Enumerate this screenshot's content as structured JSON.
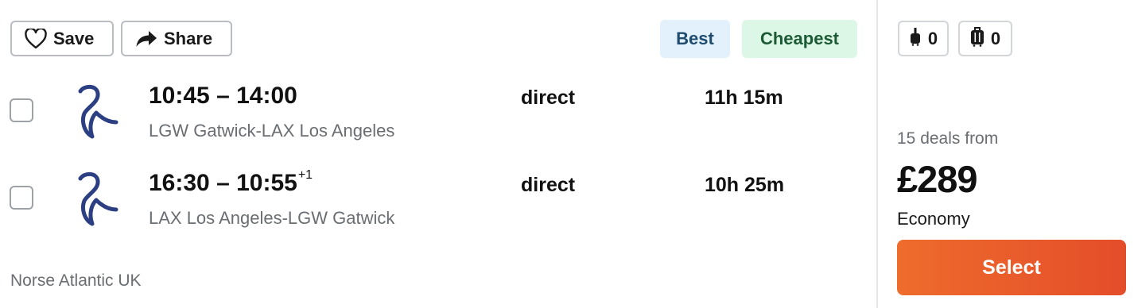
{
  "actions": {
    "save_label": "Save",
    "share_label": "Share"
  },
  "badges": {
    "best": "Best",
    "cheapest": "Cheapest"
  },
  "bags": {
    "carry_on_count": "0",
    "checked_count": "0"
  },
  "legs": [
    {
      "time": "10:45 – 14:00",
      "day_offset": "",
      "route": "LGW Gatwick-LAX Los Angeles",
      "stops": "direct",
      "duration": "11h 15m"
    },
    {
      "time": "16:30 – 10:55",
      "day_offset": "+1",
      "route": "LAX Los Angeles-LGW Gatwick",
      "stops": "direct",
      "duration": "10h 25m"
    }
  ],
  "airline": "Norse Atlantic UK",
  "offer": {
    "deals_text": "15 deals from",
    "price": "£289",
    "cabin": "Economy",
    "select_label": "Select"
  },
  "colors": {
    "best_badge_bg": "#e2f1fb",
    "cheapest_badge_bg": "#dcf7e5",
    "select_button": "#e85a2b",
    "airline_logo": "#2b3f82"
  },
  "icons": {
    "save": "heart-outline-icon",
    "share": "share-arrow-icon",
    "carry_on": "carry-on-bag-icon",
    "checked": "checked-bag-icon",
    "airline": "norse-atlantic-logo"
  }
}
